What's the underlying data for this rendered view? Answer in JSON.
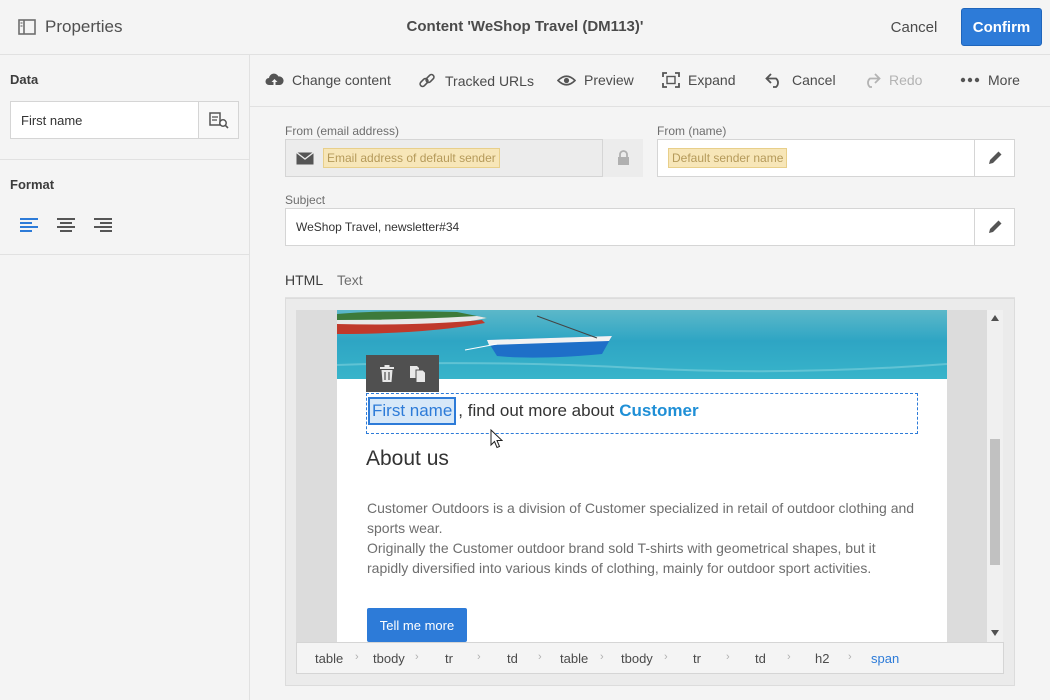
{
  "header": {
    "panel_title": "Properties",
    "title": "Content 'WeShop Travel (DM113)'",
    "cancel_label": "Cancel",
    "confirm_label": "Confirm"
  },
  "left_panel": {
    "data_label": "Data",
    "data_value": "First name",
    "format_label": "Format"
  },
  "toolbar": {
    "change_content": "Change content",
    "tracked_urls": "Tracked URLs",
    "preview": "Preview",
    "expand": "Expand",
    "cancel": "Cancel",
    "redo": "Redo",
    "more": "More"
  },
  "form": {
    "from_email_label": "From (email address)",
    "from_email_placeholder": "Email address of default sender",
    "from_name_label": "From (name)",
    "from_name_placeholder": "Default sender name",
    "subject_label": "Subject",
    "subject_value": "WeShop Travel, newsletter#34"
  },
  "tabs": [
    {
      "label": "HTML",
      "active": true
    },
    {
      "label": "Text",
      "active": false
    }
  ],
  "email": {
    "first_name_chip": "First name",
    "heading_middle": ", find out more about",
    "heading_customer": "Customer",
    "about_heading": "About us",
    "para1": "Customer Outdoors is a division of Customer specialized in retail of outdoor clothing and sports wear.",
    "para2": "Originally the Customer outdoor brand sold T-shirts with geometrical shapes, but it rapidly diversified into various kinds of clothing, mainly for outdoor sport activities.",
    "button_label": "Tell me more"
  },
  "breadcrumb": [
    "table",
    "tbody",
    "tr",
    "td",
    "table",
    "tbody",
    "tr",
    "td",
    "h2",
    "span"
  ],
  "colors": {
    "accent": "#2d7bd8",
    "placeholder_bg": "#f7e6b8"
  }
}
